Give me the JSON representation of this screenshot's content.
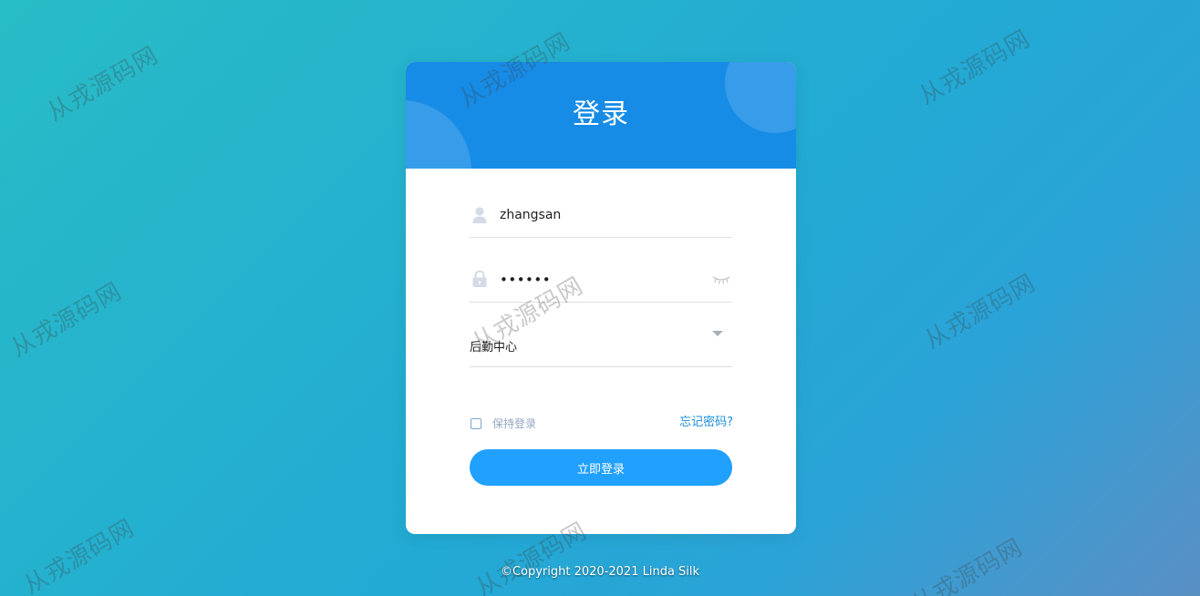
{
  "watermark": "从戎源码网",
  "login": {
    "title": "登录",
    "username_value": "zhangsan",
    "password_mask": "••••••",
    "department_value": "后勤中心",
    "remember_label": "保持登录",
    "forgot_label": "忘记密码?",
    "submit_label": "立即登录"
  },
  "footer": {
    "copyright": "©Copyright 2020-2021 Linda Silk"
  },
  "colors": {
    "header": "#178ce6",
    "button": "#20a0ff",
    "link": "#1a8fe0"
  },
  "icons": {
    "username": "user-icon",
    "password": "lock-icon",
    "password_toggle": "eye-closed-icon",
    "select": "caret-down-icon"
  }
}
